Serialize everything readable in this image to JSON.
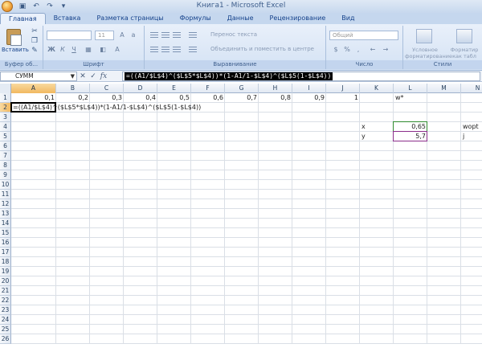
{
  "window": {
    "title": "Книга1 - Microsoft Excel",
    "qat_icons": [
      "save-icon",
      "undo-icon",
      "redo-icon",
      "customize-icon"
    ]
  },
  "ribbon": {
    "tabs": [
      {
        "label": "Главная",
        "active": true
      },
      {
        "label": "Вставка",
        "active": false
      },
      {
        "label": "Разметка страницы",
        "active": false
      },
      {
        "label": "Формулы",
        "active": false
      },
      {
        "label": "Данные",
        "active": false
      },
      {
        "label": "Рецензирование",
        "active": false
      },
      {
        "label": "Вид",
        "active": false
      }
    ],
    "clipboard": {
      "paste_label": "Вставить",
      "group_label": "Буфер об..."
    },
    "font": {
      "name_value": "",
      "size_value": "11",
      "bold": "Ж",
      "italic": "К",
      "underline": "Ч",
      "group_label": "Шрифт"
    },
    "alignment": {
      "wrap_label": "Перенос текста",
      "merge_label": "Объединить и поместить в центре",
      "group_label": "Выравнивание"
    },
    "number": {
      "format_value": "Общий",
      "group_label": "Число"
    },
    "styles": {
      "conditional_label": "Условное форматирование",
      "format_table_label": "Форматир как табл",
      "group_label": "Стили"
    }
  },
  "formula_bar": {
    "name_box": "СУММ",
    "cancel_glyph": "✕",
    "enter_glyph": "✓",
    "fx_label": "fx",
    "formula": "=((A1/$L$4)^($L$5*$L$4))*(1-A1/1-$L$4)^($L$5(1-$L$4))"
  },
  "sheet": {
    "columns": [
      "A",
      "B",
      "C",
      "D",
      "E",
      "F",
      "G",
      "H",
      "I",
      "J",
      "K",
      "L",
      "M",
      "N"
    ],
    "rows": [
      "1",
      "2",
      "3",
      "4",
      "5",
      "6",
      "7",
      "8",
      "9",
      "10",
      "11",
      "12",
      "13",
      "14",
      "15",
      "16",
      "17",
      "18",
      "19",
      "20",
      "21",
      "22",
      "23",
      "24",
      "25",
      "26"
    ],
    "row1_values": [
      "0,1",
      "0,2",
      "0,3",
      "0,4",
      "0,5",
      "0,6",
      "0,7",
      "0,8",
      "0,9",
      "1"
    ],
    "cells": {
      "L1": "w*",
      "A2": "=((A1/$L$4)^($L$5*$L$4))*(1-A1/1-$L$4)^($L$5(1-$L$4))",
      "K4": "x",
      "L4": "0,65",
      "N4": "wopt",
      "K5": "y",
      "L5": "5,7",
      "N5": "j"
    },
    "active_cell": "A2"
  },
  "colors": {
    "ref_L4": "#2e8b2e",
    "ref_L5": "#8b2e8b",
    "ribbon_text": "#15428b"
  }
}
